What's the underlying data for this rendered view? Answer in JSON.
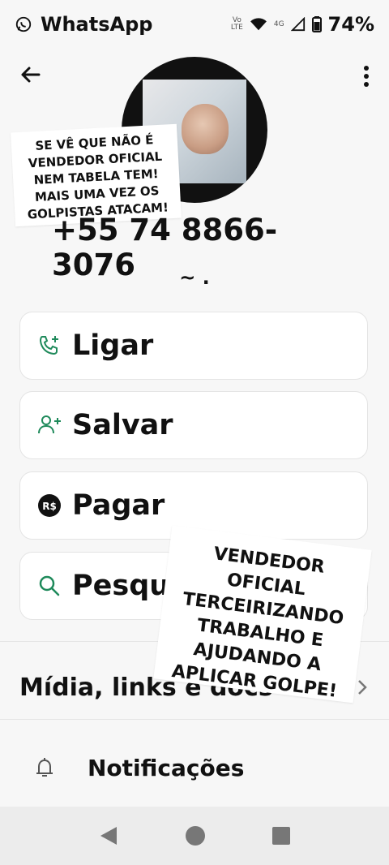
{
  "status_bar": {
    "app_name": "WhatsApp",
    "volte": "Vo",
    "lte": "LTE",
    "network": "4G",
    "battery": "74%"
  },
  "contact": {
    "phone": "+55 74 8866-3076",
    "subtitle": "~ ."
  },
  "actions": {
    "call_label": "Ligar",
    "save_label": "Salvar",
    "pay_label": "Pagar",
    "pay_badge": "R$",
    "search_label": "Pesqui"
  },
  "sections": {
    "media_label": "Mídia, links e docs",
    "notifications_label": "Notificações"
  },
  "stickers": {
    "top": [
      "SE VÊ QUE NÃO É",
      "VENDEDOR OFICIAL",
      "NEM TABELA TEM!",
      "MAIS UMA VEZ OS",
      "GOLPISTAS ATACAM!"
    ],
    "middle": [
      "VENDEDOR OFICIAL",
      "TERCEIRIZANDO",
      "TRABALHO E",
      "AJUDANDO A",
      "APLICAR GOLPE!"
    ]
  },
  "colors": {
    "accent": "#1f8a5b",
    "text": "#111111",
    "background": "#f7f7f7",
    "card": "#ffffff"
  },
  "icons": {
    "whatsapp": "whatsapp-icon",
    "back": "back-arrow-icon",
    "more": "more-vert-icon",
    "call": "phone-plus-icon",
    "save": "person-add-icon",
    "pay": "rs-badge-icon",
    "search": "search-icon",
    "chevron": "chevron-right-icon",
    "bell": "bell-icon"
  }
}
